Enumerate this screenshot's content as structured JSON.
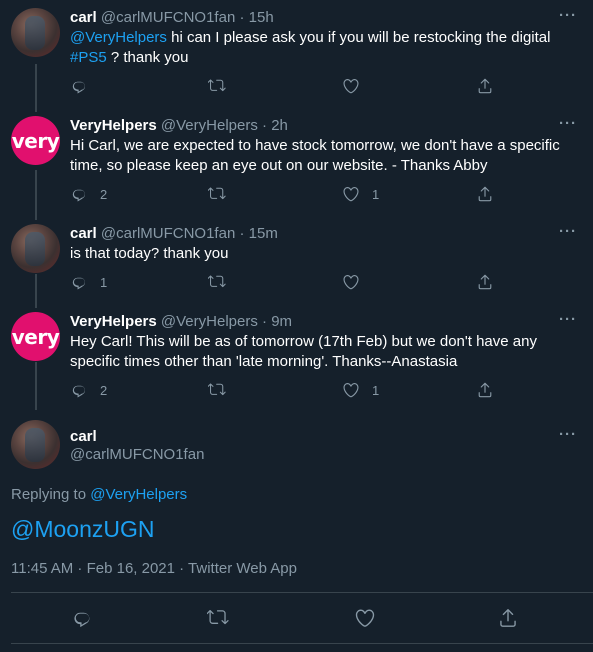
{
  "tweets": [
    {
      "avatar": "carl-avatar",
      "name": "carl",
      "handle": "@carlMUFCNO1fan",
      "time": "15h",
      "text_parts": [
        "@VeryHelpers",
        " hi can I please ask you if you will be restocking the digital ",
        "#PS5",
        " ? thank you"
      ],
      "reply_count": "",
      "like_count": ""
    },
    {
      "avatar": "very-logo",
      "avatar_text": "very",
      "name": "VeryHelpers",
      "handle": "@VeryHelpers",
      "time": "2h",
      "text": "Hi Carl, we are expected to have stock tomorrow, we don't have a specific time, so please keep an eye out on our website. - Thanks Abby",
      "reply_count": "2",
      "like_count": "1"
    },
    {
      "avatar": "carl-avatar",
      "name": "carl",
      "handle": "@carlMUFCNO1fan",
      "time": "15m",
      "text": "is that today? thank you",
      "reply_count": "1",
      "like_count": ""
    },
    {
      "avatar": "very-logo",
      "avatar_text": "very",
      "name": "VeryHelpers",
      "handle": "@VeryHelpers",
      "time": "9m",
      "text": "Hey Carl! This will be as of tomorrow (17th Feb) but we don't have any specific times other than 'late morning'. Thanks--Anastasia",
      "reply_count": "2",
      "like_count": "1"
    }
  ],
  "main_tweet": {
    "name": "carl",
    "handle": "@carlMUFCNO1fan",
    "replying_prefix": "Replying to ",
    "replying_to": "@VeryHelpers",
    "text": "@MoonzUGN",
    "timestamp": "11:45 AM · Feb 16, 2021 · Twitter Web App"
  },
  "more_label": "···",
  "colors": {
    "background": "#15202b",
    "link": "#1da1f2",
    "muted": "#8899a6",
    "divider": "#38444d",
    "very_brand": "#e1106e"
  },
  "icons": [
    "reply-icon",
    "retweet-icon",
    "like-icon",
    "share-icon",
    "more-icon"
  ]
}
